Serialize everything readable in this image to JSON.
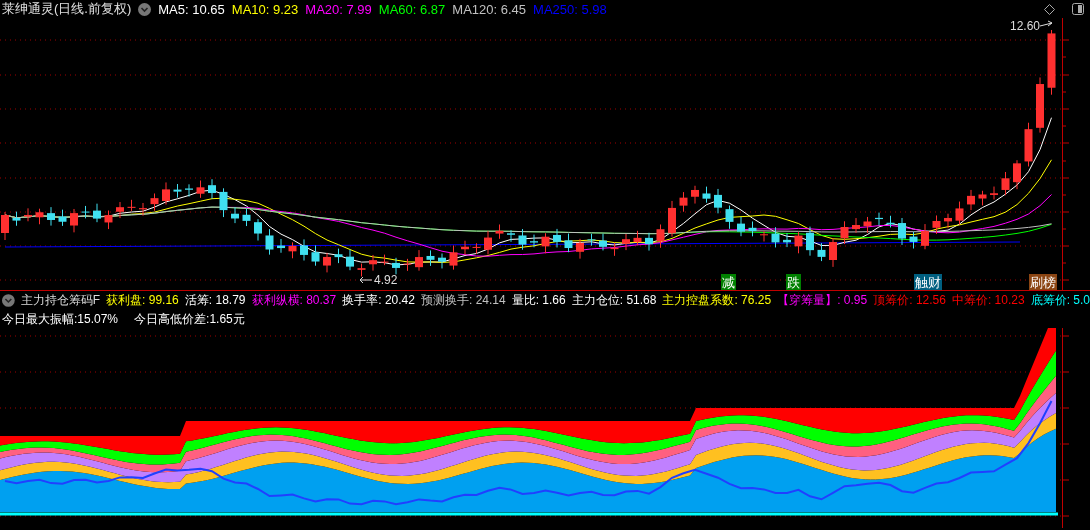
{
  "header": {
    "title": "莱绅通灵(日线.前复权)",
    "ma": [
      {
        "label": "MA5:",
        "value": "10.65",
        "color": "#ffffff"
      },
      {
        "label": "MA10:",
        "value": "9.23",
        "color": "#ffff00"
      },
      {
        "label": "MA20:",
        "value": "7.99",
        "color": "#ff00ff"
      },
      {
        "label": "MA60:",
        "value": "6.87",
        "color": "#00ff00"
      },
      {
        "label": "MA120:",
        "value": "6.45",
        "color": "#c0c0c0"
      },
      {
        "label": "MA250:",
        "value": "5.98",
        "color": "#0000ff"
      }
    ]
  },
  "price_labels": {
    "high": "12.60",
    "low": "4.92"
  },
  "signals": [
    {
      "text": "减",
      "color": "#008000"
    },
    {
      "text": "跌",
      "color": "#008000"
    },
    {
      "text": "触财",
      "color": "#005f80"
    },
    {
      "text": "刷榜",
      "color": "#8b4513"
    }
  ],
  "indicator": {
    "name": "主力持仓筹码F",
    "items": [
      {
        "label": "获利盘:",
        "value": "99.16",
        "color": "#ffff00"
      },
      {
        "label": "活筹:",
        "value": "18.79",
        "color": "#ffffff"
      },
      {
        "label": "获利纵横:",
        "value": "80.37",
        "color": "#ff00ff"
      },
      {
        "label": "换手率:",
        "value": "20.42",
        "color": "#ffffff"
      },
      {
        "label": "预测换手:",
        "value": "24.14",
        "color": "#c0c0c0"
      },
      {
        "label": "量比:",
        "value": "1.66",
        "color": "#ffffff"
      },
      {
        "label": "主力仓位:",
        "value": "51.68",
        "color": "#ffffff"
      },
      {
        "label": "主力控盘系数:",
        "value": "76.25",
        "color": "#ffff00"
      },
      {
        "label": "【穿筹量】:",
        "value": "0.95",
        "color": "#ff00ff"
      },
      {
        "label": "顶筹价:",
        "value": "12.56",
        "color": "#ff0000"
      },
      {
        "label": "中筹价:",
        "value": "10.23",
        "color": "#ff0000"
      },
      {
        "label": "底筹价:",
        "value": "5.0",
        "color": "#00ffff"
      }
    ],
    "notes": [
      "今日最大振幅:15.07%",
      "今日高低价差:1.65元"
    ]
  }
}
